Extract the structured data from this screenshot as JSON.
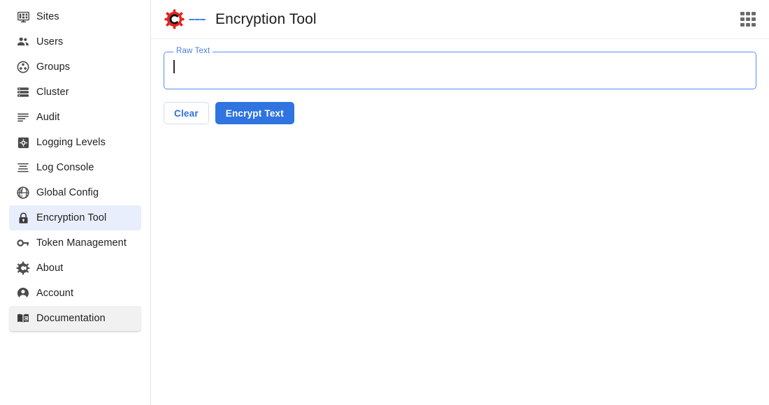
{
  "app": {
    "brand_icon": "camunda-gear-c-logo",
    "menu_icon": "hamburger-menu-icon",
    "title": "Encryption Tool",
    "apps_icon": "apps-grid-icon"
  },
  "sidebar": {
    "items": [
      {
        "label": "Sites",
        "icon": "monitor-sites-icon",
        "state": "default"
      },
      {
        "label": "Users",
        "icon": "users-icon",
        "state": "default"
      },
      {
        "label": "Groups",
        "icon": "groups-circle-icon",
        "state": "default"
      },
      {
        "label": "Cluster",
        "icon": "server-stack-icon",
        "state": "default"
      },
      {
        "label": "Audit",
        "icon": "list-lines-icon",
        "state": "default"
      },
      {
        "label": "Logging Levels",
        "icon": "gear-square-icon",
        "state": "default"
      },
      {
        "label": "Log Console",
        "icon": "log-console-lines-icon",
        "state": "default"
      },
      {
        "label": "Global Config",
        "icon": "globe-icon",
        "state": "default"
      },
      {
        "label": "Encryption Tool",
        "icon": "lock-icon",
        "state": "selected"
      },
      {
        "label": "Token Management",
        "icon": "key-icon",
        "state": "default"
      },
      {
        "label": "About",
        "icon": "gear-c-icon",
        "state": "default"
      },
      {
        "label": "Account",
        "icon": "account-person-icon",
        "state": "default"
      },
      {
        "label": "Documentation",
        "icon": "book-c-icon",
        "state": "hovered"
      }
    ]
  },
  "form": {
    "raw_text_label": "Raw Text",
    "raw_text_value": "",
    "raw_text_placeholder": "",
    "clear_label": "Clear",
    "encrypt_label": "Encrypt Text"
  },
  "colors": {
    "accent_blue": "#2f74e0",
    "label_blue": "#4a7fe0",
    "selected_bg": "#e9eefc",
    "hover_bg": "#f1f1f1",
    "logo_red": "#e8241e",
    "icon_gray": "#4a4a4a"
  }
}
